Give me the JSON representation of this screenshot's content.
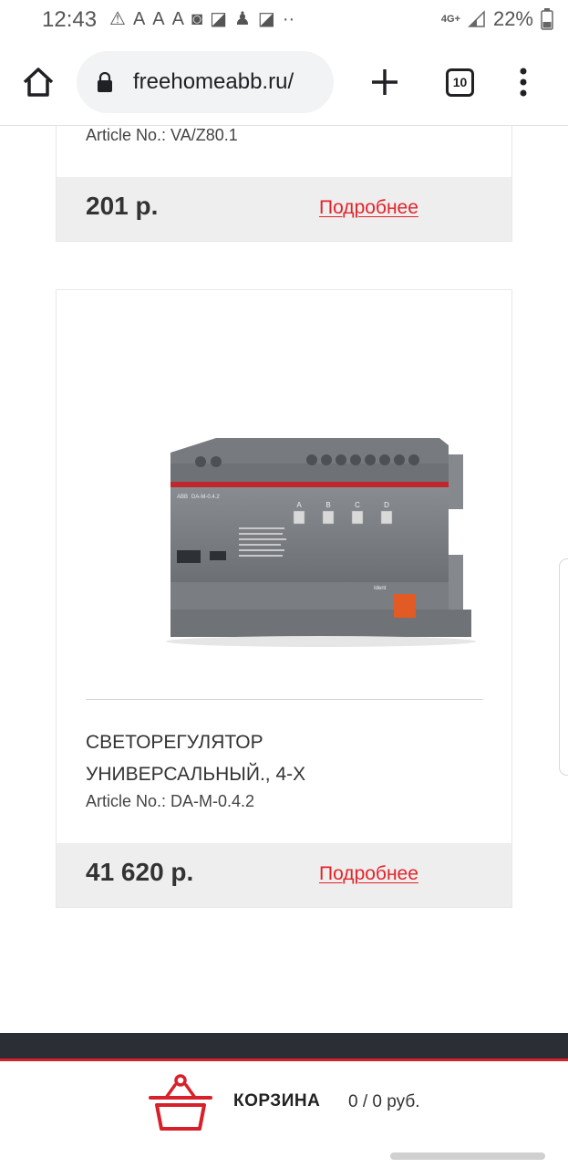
{
  "status_bar": {
    "time": "12:43",
    "network": "4G+",
    "battery": "22%"
  },
  "browser": {
    "url": "freehomeabb.ru/",
    "tab_count": "10"
  },
  "products": [
    {
      "article": "Article No.: VA/Z80.1",
      "price": "201 р.",
      "details_label": "Подробнее"
    },
    {
      "title_line1": "СВЕТОРЕГУЛЯТОР",
      "title_line2": "УНИВЕРСАЛЬНЫЙ., 4-Х",
      "article": "Article No.: DA-M-0.4.2",
      "price": "41 620 р.",
      "details_label": "Подробнее",
      "image_labels": {
        "brand": "ABB",
        "model": "DA-M-0.4.2",
        "channels": [
          "A",
          "B",
          "C",
          "D"
        ],
        "ident": "Ident"
      }
    }
  ],
  "cart": {
    "label": "КОРЗИНА",
    "total": "0 / 0 руб."
  },
  "colors": {
    "accent": "#e3242b",
    "footer_dark": "#2b2f35",
    "card_footer": "#eeeeee"
  },
  "icons": [
    "home-icon",
    "lock-icon",
    "plus-icon",
    "more-vert-icon",
    "basket-icon"
  ]
}
